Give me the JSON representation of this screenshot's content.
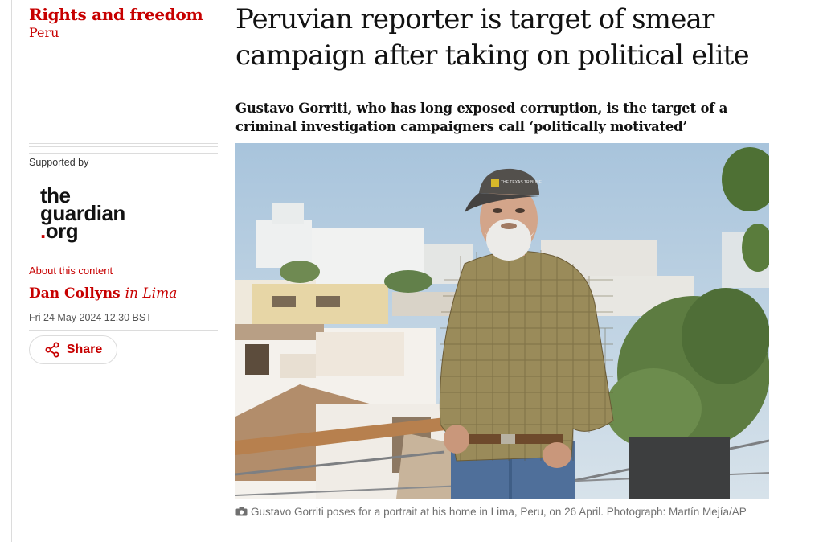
{
  "section": "Rights and freedom",
  "subsection": "Peru",
  "supported_by": "Supported by",
  "logo": {
    "line1": "the",
    "line2": "guardian",
    "line3": "org",
    "dot": "."
  },
  "about": "About this content",
  "byline": {
    "author": "Dan Collyns",
    "location": "in Lima"
  },
  "date": "Fri 24 May 2024 12.30 BST",
  "share_label": "Share",
  "headline": "Peruvian reporter is target of smear campaign after taking on political elite",
  "standfirst": "Gustavo Gorriti, who has long exposed corruption, is the target of a criminal investigation campaigners call ‘politically motivated’",
  "caption": "Gustavo Gorriti poses for a portrait at his home in Lima, Peru, on 26 April. Photograph: Martín Mejía/AP",
  "cap_text": "THE TEXAS TRIBUNE",
  "colors": {
    "accent": "#c70000",
    "rule": "#dcdcdc"
  }
}
